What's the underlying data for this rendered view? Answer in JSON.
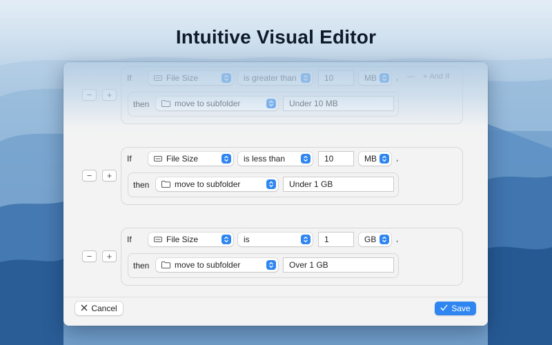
{
  "headline": "Intuitive Visual Editor",
  "accent_color": "#2f86f0",
  "rules": [
    {
      "if_label": "If",
      "field": "File Size",
      "operator": "is greater than",
      "value": "10",
      "unit": "MB",
      "trailing": ",",
      "minus_label": "—",
      "and_if_label": "And If",
      "then_label": "then",
      "action": "move to subfolder",
      "target": "Under 10 MB"
    },
    {
      "if_label": "If",
      "field": "File Size",
      "operator": "is less than",
      "value": "10",
      "unit": "MB",
      "trailing": ",",
      "then_label": "then",
      "action": "move to subfolder",
      "target": "Under 1 GB"
    },
    {
      "if_label": "If",
      "field": "File Size",
      "operator": "is",
      "value": "1",
      "unit": "GB",
      "trailing": ",",
      "then_label": "then",
      "action": "move to subfolder",
      "target": "Over 1 GB"
    }
  ],
  "row_controls": {
    "remove": "−",
    "add": "+"
  },
  "footer": {
    "cancel_label": "Cancel",
    "save_label": "Save"
  },
  "icons": {
    "field": "file-size-icon",
    "action": "folder-icon",
    "popup": "updown-chevron-icon",
    "cancel": "x-icon",
    "save": "checkmark-icon"
  }
}
